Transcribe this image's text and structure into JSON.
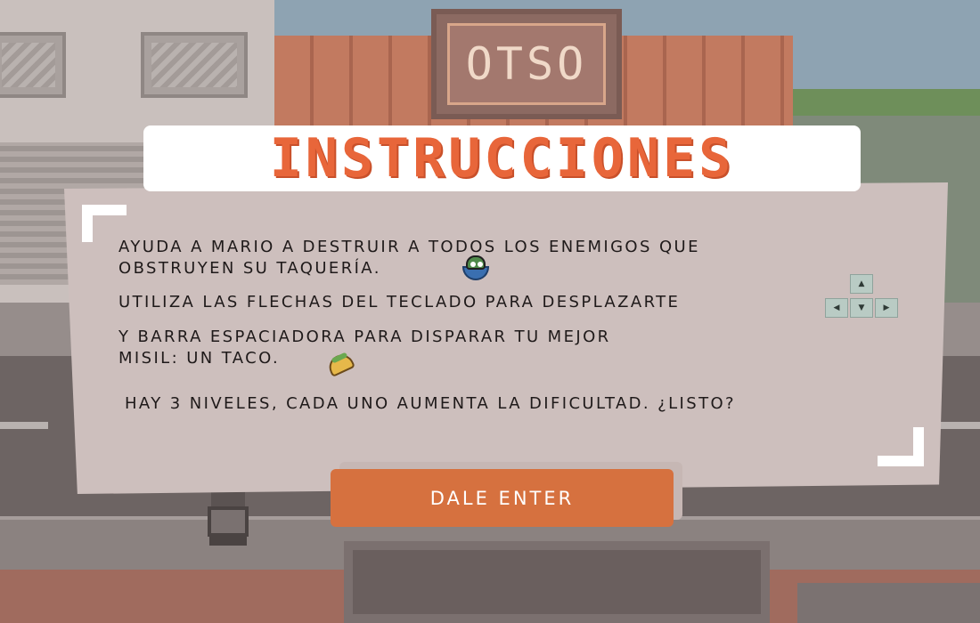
{
  "scene": {
    "shop_sign": "OTSO"
  },
  "title": "INSTRUCCIONES",
  "instructions": {
    "line1": "AYUDA A MARIO A DESTRUIR A TODOS LOS ENEMIGOS QUE",
    "line2": "OBSTRUYEN SU TAQUERÍA.",
    "line3": "UTILIZA LAS FLECHAS DEL TECLADO PARA DESPLAZARTE",
    "line4": "Y BARRA ESPACIADORA PARA DISPARAR TU MEJOR",
    "line5": "MISIL: UN TACO.",
    "line6": "HAY 3 NIVELES, CADA UNO AUMENTA LA DIFICULTAD. ¿LISTO?"
  },
  "arrow_keys": {
    "up": "▲",
    "left": "◀",
    "down": "▼",
    "right": "▶"
  },
  "icons": {
    "enemy": "salad-bowl-enemy-icon",
    "taco": "taco-icon"
  },
  "button": {
    "label": "DALE ENTER"
  },
  "colors": {
    "title": "#e8663a",
    "panel": "#cdbfbd",
    "button": "#d6713f",
    "text": "#1f1a1a"
  }
}
